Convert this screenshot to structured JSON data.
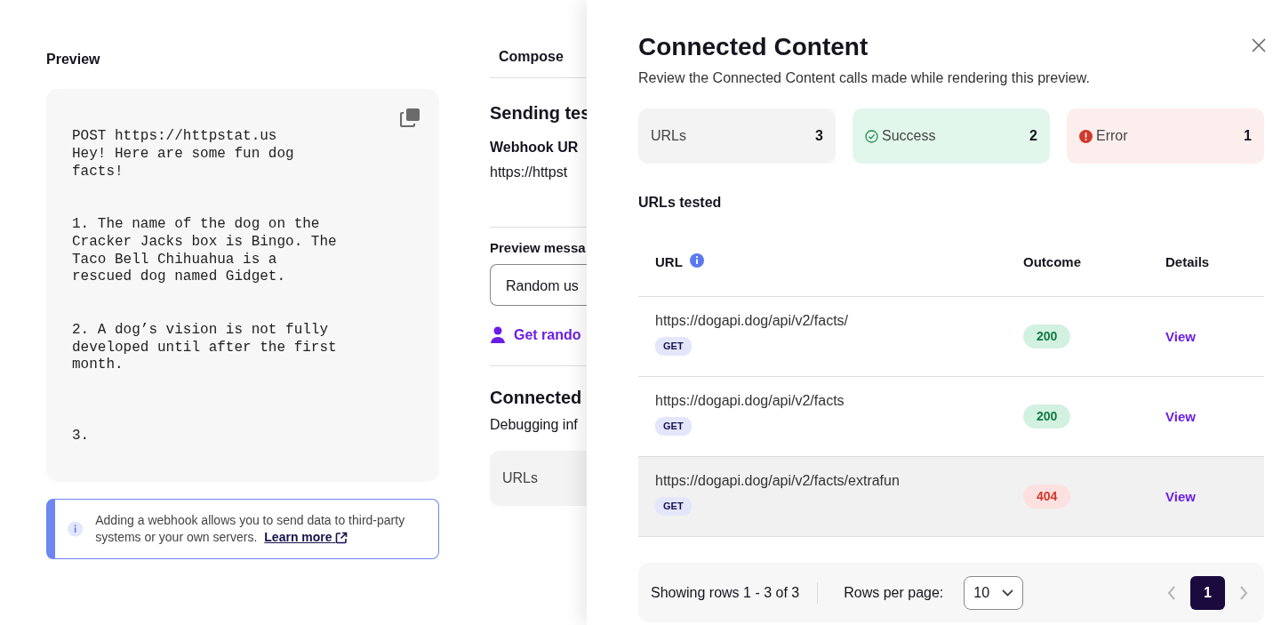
{
  "preview": {
    "title": "Preview",
    "code": "POST https://httpstat.us\nHey! Here are some fun dog facts!\n\n\n1. The name of the dog on the Cracker Jacks box is Bingo. The Taco Bell Chihuahua is a rescued dog named Gidget.\n\n\n2. A dog’s vision is not fully developed until after the first month.\n\n\n\n3.",
    "notice": "Adding a webhook allows you to send data to third-party systems or your own servers.",
    "notice_link": "Learn more"
  },
  "compose": {
    "tab": "Compose",
    "section_title": "Sending tes",
    "webhook_label": "Webhook UR",
    "webhook_value": "https://httpst",
    "preview_label": "Preview messa",
    "preview_select": "Random us",
    "random_link": "Get rando",
    "cc_title": "Connected",
    "cc_text": "Debugging inf",
    "cc_card": "URLs"
  },
  "drawer": {
    "title": "Connected Content",
    "subtitle": "Review the Connected Content calls made while rendering this preview.",
    "summary": [
      {
        "kind": "neutral",
        "label": "URLs",
        "count": "3"
      },
      {
        "kind": "success",
        "label": "Success",
        "count": "2"
      },
      {
        "kind": "error",
        "label": "Error",
        "count": "1"
      }
    ],
    "table_title": "URLs tested",
    "table": {
      "columns": [
        "URL",
        "Outcome",
        "Details"
      ],
      "rows": [
        {
          "url": "https://dogapi.dog/api/v2/facts/",
          "method": "GET",
          "outcome": "200",
          "kind": "success",
          "details": "View",
          "highlighted": false
        },
        {
          "url": "https://dogapi.dog/api/v2/facts",
          "method": "GET",
          "outcome": "200",
          "kind": "success",
          "details": "View",
          "highlighted": false
        },
        {
          "url": "https://dogapi.dog/api/v2/facts/extrafun",
          "method": "GET",
          "outcome": "404",
          "kind": "error",
          "details": "View",
          "highlighted": true
        }
      ]
    },
    "footer": {
      "showing": "Showing rows 1 - 3 of 3",
      "rows_label": "Rows per page:",
      "rows_value": "10",
      "prev_disabled": true,
      "next_disabled": true,
      "pages": [
        {
          "label": "1",
          "selected": true
        }
      ]
    }
  }
}
